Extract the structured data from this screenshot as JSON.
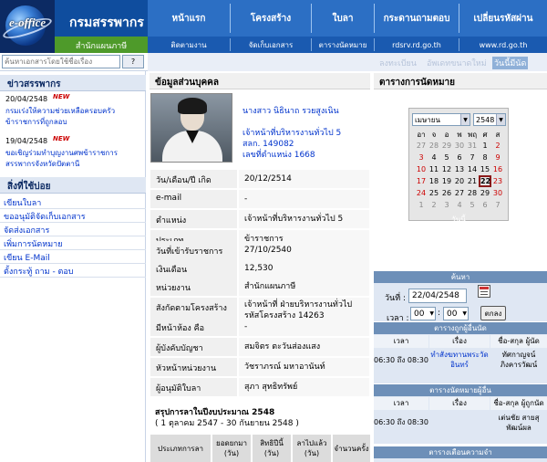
{
  "header": {
    "logo_text": "e-office",
    "brand": "กรมสรรพากร",
    "office_label": "สำนักแผนภาษี",
    "nav": [
      "หน้าแรก",
      "โครงสร้าง",
      "ใบลา",
      "กระดานถามตอบ",
      "เปลี่ยนรหัสผ่าน"
    ],
    "subnav": [
      "ติดตามงาน",
      "จัดเก็บเอกสาร",
      "ตารางนัดหมาย",
      "rdsrv.rd.go.th",
      "www.rd.go.th"
    ]
  },
  "search": {
    "placeholder": "ค้นหาเอกสารโดยใช้ชื่อเรื่อง",
    "go_label": "?",
    "quick": [
      "ลงทะเบียน",
      "อัพเดทขนาดใหม่",
      "วันนี้มีนัด"
    ]
  },
  "left": {
    "news_title": "ข่าวสรรพากร",
    "news": [
      {
        "date": "20/04/2548",
        "badge": "NEW",
        "text": "กรมเร่งให้ความช่วยเหลือครอบครัวข้าราชการที่ถูกลอบ"
      },
      {
        "date": "19/04/2548",
        "badge": "NEW",
        "text": "ขอเชิญร่วมทำบุญงานศพข้าราชการสรรพากรจังหวัดปัตตานี"
      }
    ],
    "menu_title": "สิ่งที่ใช้บ่อย",
    "menu": [
      "เขียนใบลา",
      "ขออนุมัติจัดเก็บเอกสาร",
      "จัดส่งเอกสาร",
      "เพิ่มการนัดหมาย",
      "เขียน E-Mail",
      "ตั้งกระทู้ ถาม - ตอบ"
    ]
  },
  "profile": {
    "title": "ข้อมูลส่วนบุคคล",
    "name": "นางสาว นิธินาถ รวยสูงเนิน",
    "position": "เจ้าหน้าที่บริหารงานทั่วไป 5",
    "id_line": "สลก. 149082",
    "pos_no": "เลขที่ตำแหน่ง 1668",
    "rows": [
      {
        "label": "วัน/เดือน/ปี เกิด",
        "value": "20/12/2514"
      },
      {
        "label": "e-mail",
        "value": "-"
      },
      {
        "label": "ตำแหน่ง",
        "value": "เจ้าหน้าที่บริหารงานทั่วไป 5"
      },
      {
        "label": "ประเภท",
        "value": "ข้าราชการ"
      },
      {
        "label": "วันที่เข้ารับราชการ",
        "value": "27/10/2540"
      },
      {
        "label": "เงินเดือน",
        "value": "12,530"
      },
      {
        "label": "หน่วยงาน",
        "value": "สำนักแผนภาษี"
      },
      {
        "label": "สังกัดตามโครงสร้าง",
        "value": "เจ้าหน้าที่ ฝ่ายบริหารงานทั่วไป รหัสโครงสร้าง 14263"
      },
      {
        "label": "มีหน้าห้อง คือ",
        "value": "-"
      },
      {
        "label": "ผู้บังคับบัญชา",
        "value": "สมจิตร ตะวันส่องแสง"
      },
      {
        "label": "หัวหน้าหน่วยงาน",
        "value": "วัชราภรณ์ มหาอานันท์"
      },
      {
        "label": "ผู้อนุมัติใบลา",
        "value": "สุภา สุทธิทรัพย์"
      }
    ],
    "summary_title": "สรุปการลาในปีงบประมาณ 2548",
    "summary_sub": "( 1 ตุลาคม 2547 - 30 กันยายน 2548 )",
    "summary_cols": [
      "ประเภทการลา",
      "ยอดยกมา (วัน)",
      "สิทธิปีนี้ (วัน)",
      "ลาไปแล้ว (วัน)",
      "จำนวนครั้ง"
    ]
  },
  "calendar": {
    "title": "ตารางการนัดหมาย",
    "month": "เมษายน",
    "year": "2548",
    "dow": [
      "อา",
      "จ",
      "อ",
      "พ",
      "พฤ",
      "ศ",
      "ส"
    ],
    "weeks": [
      [
        "27",
        "28",
        "29",
        "30",
        "31",
        "1",
        "2"
      ],
      [
        "3",
        "4",
        "5",
        "6",
        "7",
        "8",
        "9"
      ],
      [
        "10",
        "11",
        "12",
        "13",
        "14",
        "15",
        "16"
      ],
      [
        "17",
        "18",
        "19",
        "20",
        "21",
        "22",
        "23"
      ],
      [
        "24",
        "25",
        "26",
        "27",
        "28",
        "29",
        "30"
      ],
      [
        "1",
        "2",
        "3",
        "4",
        "5",
        "6",
        "7"
      ]
    ],
    "today_label": "วันนี้",
    "today": "22"
  },
  "find": {
    "title": "ค้นหา",
    "date_label": "วันที่ :",
    "date_value": "22/04/2548",
    "time_label": "เวลา :",
    "hour": "00",
    "minute": "00",
    "ok_label": "ตกลง"
  },
  "schedule_today": {
    "title": "ตารางถูกผู้อื่นนัด",
    "cols": [
      "เวลา",
      "เรื่อง",
      "ชื่อ-สกุล ผู้นัด"
    ],
    "rows": [
      {
        "time": "06:30 ถึง 08:30",
        "subject": "ทำสังฆทานพระวัดอินทร์",
        "who": "ทัศกาญจน์ ภิงคารวัฒน์"
      }
    ]
  },
  "schedule_mine": {
    "title": "ตารางนัดหมายผู้อื่น",
    "cols": [
      "เวลา",
      "เรื่อง",
      "ชื่อ-สกุล ผู้ถูกนัด"
    ],
    "rows": [
      {
        "time": "06:30 ถึง 08:30",
        "subject": "",
        "who": "เต่นชัย สายสุพัฒน์ผล"
      }
    ]
  },
  "reminder": {
    "title": "ตารางเตือนความจำ"
  }
}
